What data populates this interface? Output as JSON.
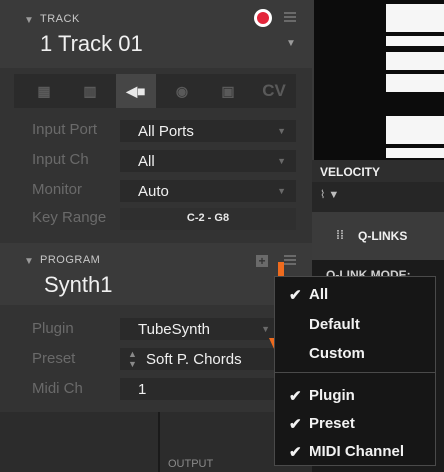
{
  "track": {
    "section_label": "TRACK",
    "name": "1 Track 01",
    "tabs": [
      {
        "icon": "grid-icon",
        "glyph": "▦",
        "active": false
      },
      {
        "icon": "keyboard-icon",
        "glyph": "▥",
        "active": false
      },
      {
        "icon": "plug-icon",
        "glyph": "◀",
        "active": true
      },
      {
        "icon": "cloud-icon",
        "glyph": "◉",
        "active": false
      },
      {
        "icon": "box-icon",
        "glyph": "▣",
        "active": false
      },
      {
        "icon": "cv-label",
        "glyph": "CV",
        "active": false
      }
    ],
    "rows": [
      {
        "label": "Input Port",
        "value": "All Ports"
      },
      {
        "label": "Input Ch",
        "value": "All"
      },
      {
        "label": "Monitor",
        "value": "Auto"
      },
      {
        "label": "Key Range",
        "value": "C-2 - G8"
      }
    ]
  },
  "program": {
    "section_label": "PROGRAM",
    "name": "Synth1",
    "rows": [
      {
        "label": "Plugin",
        "value": "TubeSynth"
      },
      {
        "label": "Preset",
        "value": "Soft P. Chords"
      },
      {
        "label": "Midi Ch",
        "value": "1"
      }
    ]
  },
  "right": {
    "velocity_label": "VELOCITY",
    "qlinks_label": "Q-LINKS",
    "qlink_mode_label": "Q-LINK MODE:",
    "output_label": "OUTPUT"
  },
  "menu": {
    "items": [
      {
        "label": "All",
        "checked": true
      },
      {
        "label": "Default",
        "checked": false
      },
      {
        "label": "Custom",
        "checked": false
      },
      {
        "label": "Plugin",
        "checked": true
      },
      {
        "label": "Preset",
        "checked": true
      },
      {
        "label": "MIDI Channel",
        "checked": true
      }
    ],
    "check_glyph": "✔"
  },
  "colors": {
    "arrow": "#ee6b1e",
    "record": "#e3263b"
  }
}
